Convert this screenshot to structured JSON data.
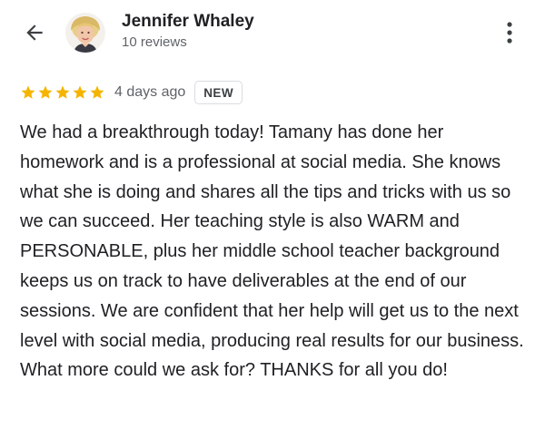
{
  "reviewer": {
    "name": "Jennifer Whaley",
    "review_count": "10 reviews"
  },
  "review": {
    "rating": 5,
    "rating_max": 5,
    "date": "4 days ago",
    "badge": "NEW",
    "text": "We had a breakthrough today! Tamany has done her homework and is a professional at social media. She knows what she is doing and shares all the tips and tricks with us so we can succeed. Her teaching style is also WARM and PERSONABLE, plus her middle school teacher background keeps us on track to have deliverables at the end of our sessions. We are confident that her help will get us to the next level with social media, producing real results for our business. What more could we ask for? THANKS for all you do!"
  },
  "icons": {
    "back": "arrow-back-icon",
    "more": "more-vertical-icon",
    "star": "star-icon"
  },
  "colors": {
    "star": "#f5b400",
    "text": "#202124",
    "secondary": "#5f6368",
    "badge_border": "#dadce0"
  }
}
